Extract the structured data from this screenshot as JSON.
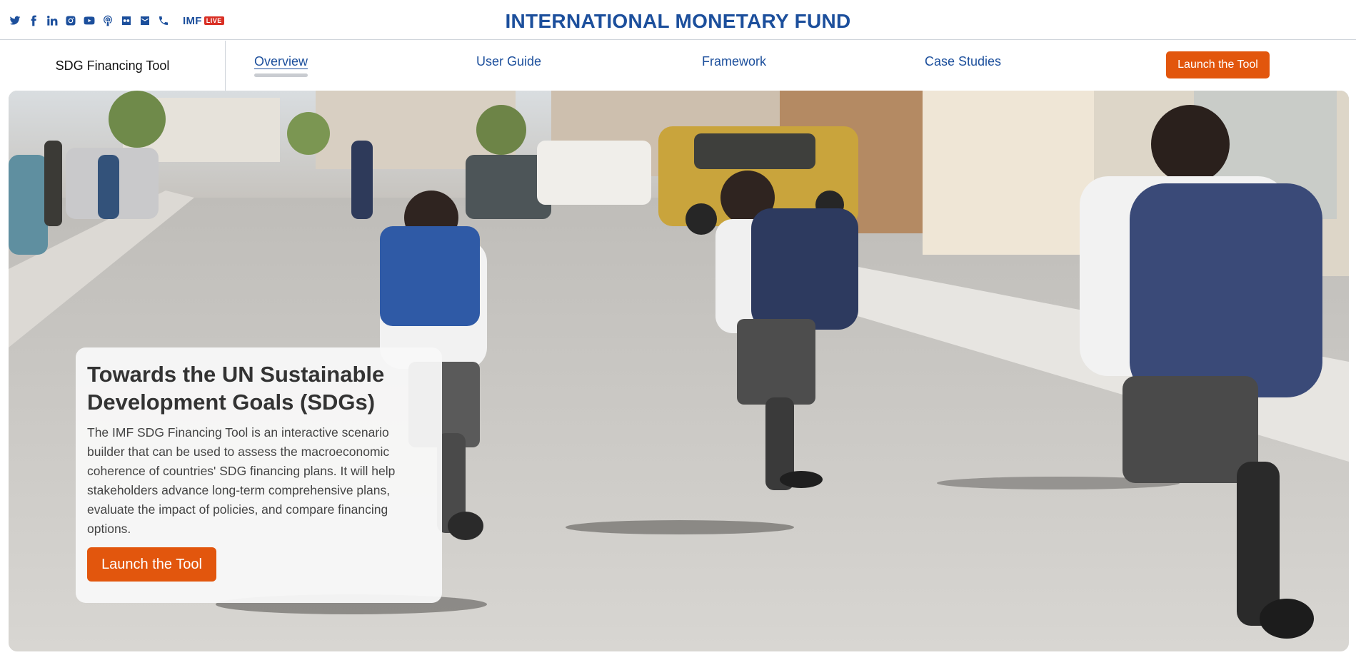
{
  "social": {
    "icons": [
      "twitter-icon",
      "facebook-icon",
      "linkedin-icon",
      "instagram-icon",
      "youtube-icon",
      "podcast-icon",
      "flickr-icon",
      "email-icon",
      "phone-icon"
    ],
    "imf_live_prefix": "IMF",
    "imf_live_badge": "LIVE"
  },
  "header": {
    "title": "INTERNATIONAL MONETARY FUND"
  },
  "nav": {
    "product": "SDG Financing Tool",
    "links": [
      "Overview",
      "User Guide",
      "Framework",
      "Case Studies"
    ],
    "active": "Overview",
    "launch_label": "Launch the Tool"
  },
  "hero": {
    "image_subject": "children-running-street-photo",
    "title": "Towards the UN Sustainable Development Goals (SDGs)",
    "body": "The IMF SDG Financing Tool is an interactive scenario builder that can be used to assess the macroeconomic coherence of countries' SDG financing plans. It will help stakeholders advance long-term comprehensive plans, evaluate the impact of policies, and compare financing options.",
    "button_label": "Launch the Tool"
  },
  "colors": {
    "brand_blue": "#1c4f9c",
    "accent_orange": "#e2560d",
    "live_red": "#d93025"
  }
}
